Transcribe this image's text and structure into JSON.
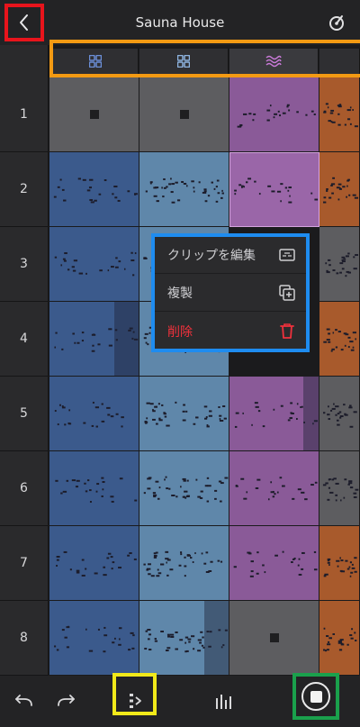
{
  "header": {
    "title": "Sauna House",
    "back_icon": "chevron-left-icon",
    "tuner_icon": "tuner-icon"
  },
  "tracks": [
    {
      "icon": "drum-grid-icon",
      "color": "#6b8ed6"
    },
    {
      "icon": "drum-grid-icon",
      "color": "#8eb4e0"
    },
    {
      "icon": "wave-icon",
      "color": "#c97ad8"
    },
    {
      "icon": "",
      "color": "#a85a2c"
    }
  ],
  "scenes": [
    "1",
    "2",
    "3",
    "4",
    "5",
    "6",
    "7",
    "8"
  ],
  "clips": [
    [
      "grey-stop",
      "purple",
      "orange"
    ],
    [
      "blue",
      "lightblue",
      "purple-selected",
      "orange"
    ]
  ],
  "context_menu": {
    "items": [
      {
        "label": "クリップを編集",
        "icon": "edit-clip-icon"
      },
      {
        "label": "複製",
        "icon": "duplicate-icon"
      },
      {
        "label": "削除",
        "icon": "trash-icon"
      }
    ]
  },
  "toolbar": {
    "undo_icon": "undo-icon",
    "redo_icon": "redo-icon",
    "scene_launch_icon": "scene-launch-icon",
    "mixer_icon": "mixer-icon",
    "stop_icon": "stop-icon"
  },
  "colors": {
    "grey": "#5d5d60",
    "blue": "#3b5a8c",
    "lightblue": "#5f87aa",
    "purple": "#8a5a98",
    "orange": "#a85a2c",
    "danger": "#f0313c"
  }
}
